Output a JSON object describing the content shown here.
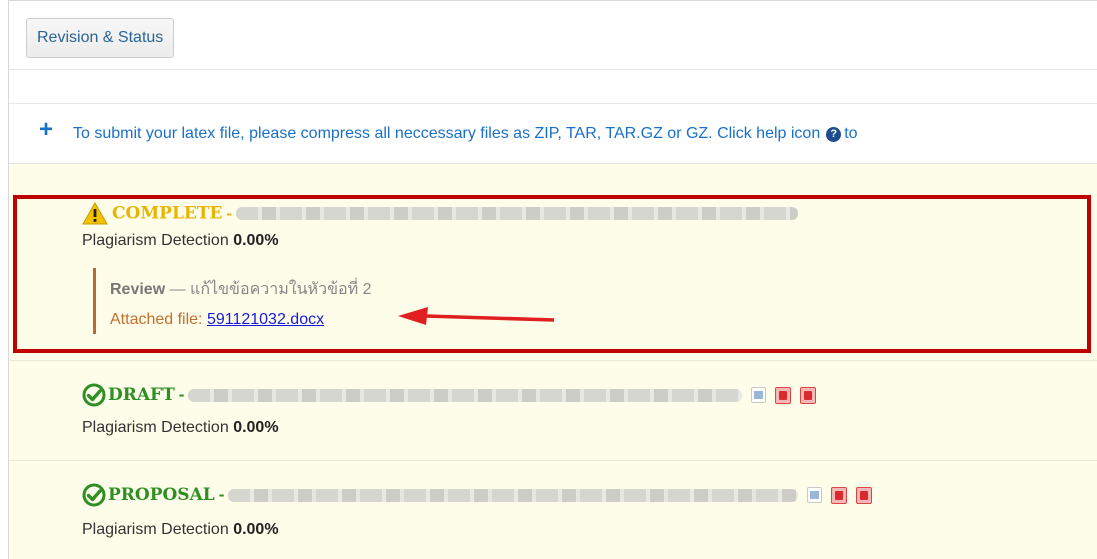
{
  "toolbar": {
    "tab_label": "Revision & Status"
  },
  "info": {
    "plus_icon": "plus-icon",
    "text_before": "To submit your latex file, please compress all neccessary files as ZIP, TAR, TAR.GZ or GZ. Click help icon",
    "help_icon": "question-circle-icon",
    "text_after": "to"
  },
  "items": [
    {
      "status": "COMPLETE",
      "status_icon": "warning-icon",
      "separator": "-",
      "plagiarism_label": "Plagiarism Detection",
      "plagiarism_value": "0.00%",
      "review_label": "Review",
      "review_text": " — แก้ไขข้อความในหัวข้อที่ 2",
      "attached_label": "Attached file: ",
      "attached_file": "591121032.docx"
    },
    {
      "status": "DRAFT",
      "status_icon": "check-circle-icon",
      "separator": "-",
      "plagiarism_label": "Plagiarism Detection",
      "plagiarism_value": "0.00%"
    },
    {
      "status": "PROPOSAL",
      "status_icon": "check-circle-icon",
      "separator": "-",
      "plagiarism_label": "Plagiarism Detection",
      "plagiarism_value": "0.00%"
    }
  ],
  "colors": {
    "highlight": "#c00000",
    "complete": "#e8b400",
    "ok": "#2f8f24",
    "link": "#1a70c8"
  }
}
